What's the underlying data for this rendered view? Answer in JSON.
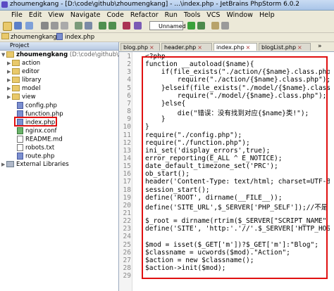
{
  "window": {
    "title": "zhoumengkang - [D:\\code\\github\\zhoumengkang] - ...\\index.php - JetBrains PhpStorm 6.0.2"
  },
  "menu": [
    "File",
    "Edit",
    "View",
    "Navigate",
    "Code",
    "Refactor",
    "Run",
    "Tools",
    "VCS",
    "Window",
    "Help"
  ],
  "toolbar": {
    "run_config": "Unnamed"
  },
  "breadcrumb": {
    "project": "zhoumengkang",
    "file": "index.php"
  },
  "project_panel": {
    "header": "Project",
    "root": "zhoumengkang",
    "root_path": "(D:\\code\\github\\zhoumengkang)",
    "items": [
      {
        "label": "action",
        "kind": "folder"
      },
      {
        "label": "editor",
        "kind": "folder"
      },
      {
        "label": "library",
        "kind": "folder"
      },
      {
        "label": "model",
        "kind": "folder"
      },
      {
        "label": "view",
        "kind": "folder"
      },
      {
        "label": "config.php",
        "kind": "php"
      },
      {
        "label": "function.php",
        "kind": "php"
      },
      {
        "label": "index.php",
        "kind": "php"
      },
      {
        "label": "nginx.conf",
        "kind": "conf"
      },
      {
        "label": "README.md",
        "kind": "txt"
      },
      {
        "label": "robots.txt",
        "kind": "txt"
      },
      {
        "label": "route.php",
        "kind": "php"
      }
    ],
    "external": "External Libraries"
  },
  "tabs": [
    {
      "label": "blog.php"
    },
    {
      "label": "header.php"
    },
    {
      "label": "index.php",
      "active": true
    },
    {
      "label": "blogList.php"
    }
  ],
  "editor": {
    "lines": [
      "<?php",
      "function __autoload($name){",
      "    if(file_exists(\"./action/{$name}.class.php",
      "        require(\"./action/{$name}.class.php\");",
      "    }elseif(file_exists(\"./model/{$name}.class.",
      "        require(\"./model/{$name}.class.php\");",
      "    }else{",
      "        die(\"错误：没有找到对应{$name}类!\");",
      "    }",
      "}",
      "require(\"./config.php\");",
      "require(\"./function.php\");",
      "ini_set('display_errors',true);",
      "error_reporting(E_ALL ^ E_NOTICE);",
      "date_default_timezone_set('PRC');",
      "ob_start();",
      "header('Content-Type: text/html; charset=UTF-8",
      "session_start();",
      "define('ROOT', dirname(__FILE__));",
      "define('SITE_URL',$_SERVER['PHP_SELF']);//不是",
      "",
      "$_root = dirname(rtrim($_SERVER[\"SCRIPT_NAME\"",
      "define('SITE', 'http:'.'//'.$_SERVER['HTTP_HOS",
      "",
      "$mod = isset($_GET['m'])?$_GET['m']:\"Blog\";",
      "$classname = ucwords($mod).\"Action\";",
      "$action = new $classname();",
      "$action->init($mod);",
      ""
    ]
  },
  "colors": {
    "highlight": "#e01010",
    "selection": "#c5d7f0"
  }
}
